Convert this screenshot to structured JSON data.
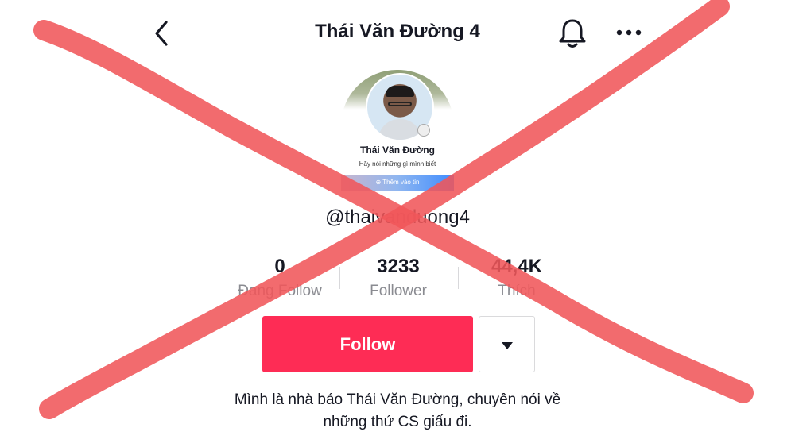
{
  "header": {
    "back_icon": "chevron-left-icon",
    "title": "Thái Văn Đường 4",
    "bell_icon": "bell-icon",
    "more_icon": "more-horizontal-icon"
  },
  "avatar_card": {
    "name": "Thái Văn Đường",
    "subtitle": "Hãy nói những gì mình biết",
    "button": "⊕ Thêm vào tin"
  },
  "profile": {
    "handle": "@thaivanduong4"
  },
  "stats": [
    {
      "value": "0",
      "label": "Đang Follow"
    },
    {
      "value": "3233",
      "label": "Follower"
    },
    {
      "value": "44,4K",
      "label": "Thích"
    }
  ],
  "actions": {
    "follow_label": "Follow",
    "dropdown_icon": "caret-down-icon",
    "accent_color": "#fe2c55"
  },
  "bio": {
    "line1": "Mình là nhà báo Thái Văn Đường, chuyên nói về",
    "line2": "những thứ CS giấu đi."
  },
  "overlay": {
    "cross_color": "#f0565a"
  }
}
